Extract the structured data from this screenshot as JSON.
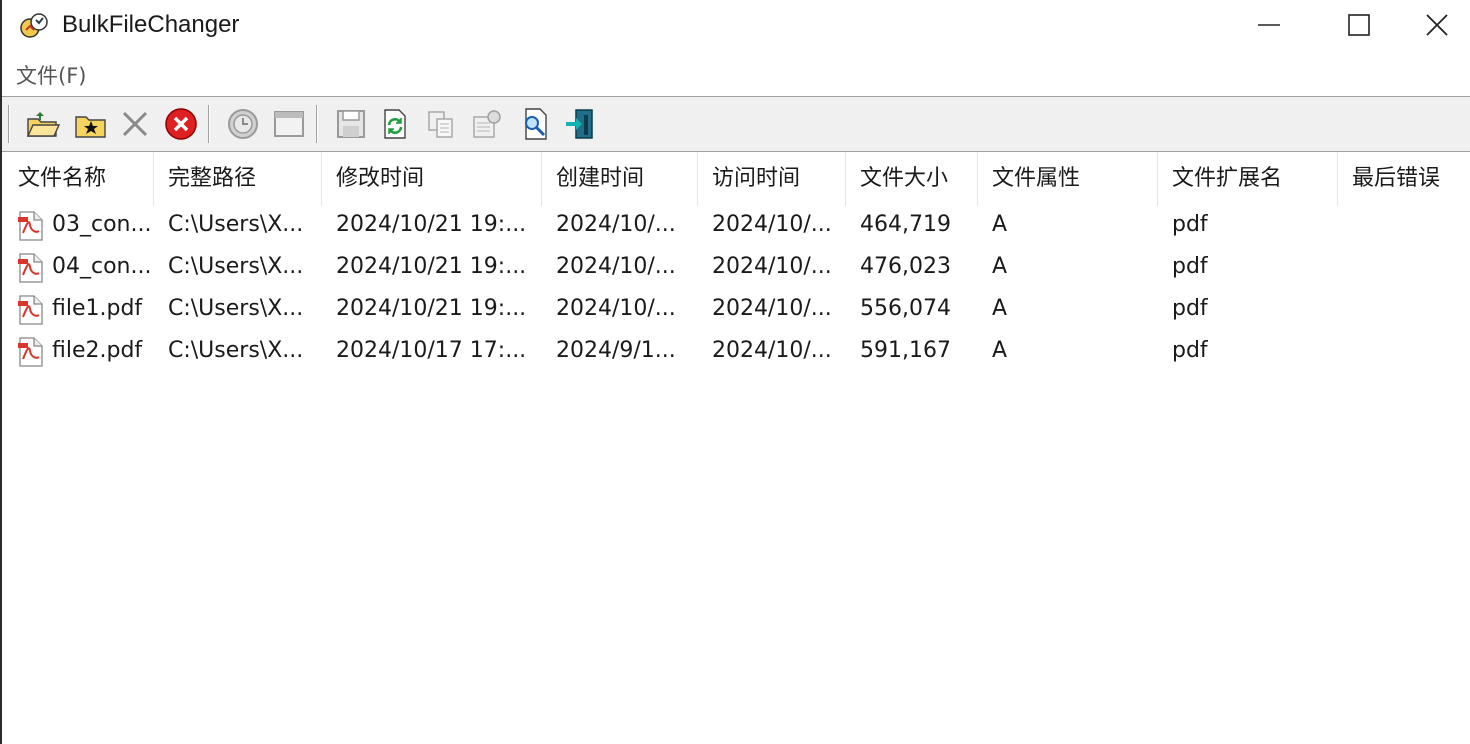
{
  "window": {
    "title": "BulkFileChanger"
  },
  "menu": {
    "items": [
      "文件(F)"
    ]
  },
  "toolbar": {
    "buttons": [
      {
        "name": "open-folder-icon"
      },
      {
        "name": "add-files-icon"
      },
      {
        "name": "remove-icon"
      },
      {
        "name": "clear-list-icon"
      },
      {
        "name": "change-time-icon"
      },
      {
        "name": "window-icon"
      },
      {
        "name": "save-icon"
      },
      {
        "name": "refresh-icon"
      },
      {
        "name": "copy-icon"
      },
      {
        "name": "properties-icon"
      },
      {
        "name": "find-icon"
      },
      {
        "name": "exit-icon"
      }
    ]
  },
  "table": {
    "columns": [
      "文件名称",
      "完整路径",
      "修改时间",
      "创建时间",
      "访问时间",
      "文件大小",
      "文件属性",
      "文件扩展名",
      "最后错误"
    ],
    "rows": [
      [
        "03_con...",
        "C:\\Users\\X...",
        "2024/10/21 19:...",
        "2024/10/...",
        "2024/10/...",
        "464,719",
        "A",
        "pdf",
        ""
      ],
      [
        "04_con...",
        "C:\\Users\\X...",
        "2024/10/21 19:...",
        "2024/10/...",
        "2024/10/...",
        "476,023",
        "A",
        "pdf",
        ""
      ],
      [
        "file1.pdf",
        "C:\\Users\\X...",
        "2024/10/21 19:...",
        "2024/10/...",
        "2024/10/...",
        "556,074",
        "A",
        "pdf",
        ""
      ],
      [
        "file2.pdf",
        "C:\\Users\\X...",
        "2024/10/17 17:...",
        "2024/9/1...",
        "2024/10/...",
        "591,167",
        "A",
        "pdf",
        ""
      ]
    ]
  },
  "colors": {
    "toolbar_bg": "#f0f0f0",
    "pdf_red": "#d9352b"
  }
}
